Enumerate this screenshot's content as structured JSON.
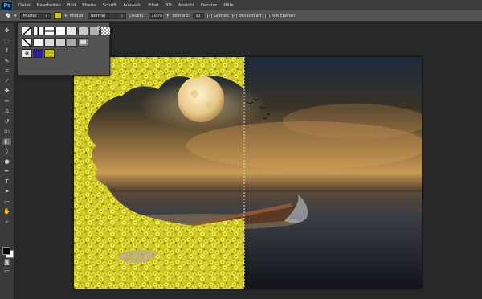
{
  "app": {
    "logo": "Ps"
  },
  "menu": [
    "Datei",
    "Bearbeiten",
    "Bild",
    "Ebene",
    "Schrift",
    "Auswahl",
    "Filter",
    "3D",
    "Ansicht",
    "Fenster",
    "Hilfe"
  ],
  "options": {
    "tool_icon": "paint-bucket-icon",
    "fill_source": "Muster",
    "pattern_color": "#c8c21a",
    "mode_label": "Modus:",
    "mode_value": "Normal",
    "opacity_label": "Deckkr.:",
    "opacity_value": "100%",
    "tolerance_label": "Toleranz:",
    "tolerance_value": "32",
    "anti_alias_label": "Glätten",
    "anti_alias_checked": true,
    "contiguous_label": "Benachbart",
    "contiguous_checked": true,
    "all_layers_label": "Alle Ebenen",
    "all_layers_checked": false
  },
  "toolbar": {
    "icons": [
      "move-icon",
      "marquee-icon",
      "lasso-icon",
      "quick-select-icon",
      "crop-icon",
      "eyedropper-icon",
      "healing-brush-icon",
      "brush-icon",
      "clone-stamp-icon",
      "history-brush-icon",
      "eraser-icon",
      "paint-bucket-icon",
      "blur-icon",
      "dodge-icon",
      "pen-icon",
      "type-icon",
      "path-select-icon",
      "rectangle-icon",
      "hand-icon",
      "zoom-icon"
    ],
    "foreground_color": "#000000",
    "background_color": "#ffffff"
  },
  "pattern_picker": {
    "gear_icon": "gear-icon",
    "patterns": [
      "diagonal-stroke",
      "vertical-bar",
      "horizontal-bar",
      "white",
      "light-gray",
      "gray",
      "mid-gray",
      "checker",
      "diagonal-stroke-2",
      "white-2",
      "light-gray-2",
      "silver",
      "gray-2",
      "frame",
      "gear-pattern",
      "blue-texture",
      "yellow-flowers"
    ]
  },
  "document": {
    "scene": "moonlit-sea-with-rowboat",
    "fill_pattern": "yellow-flowers"
  }
}
